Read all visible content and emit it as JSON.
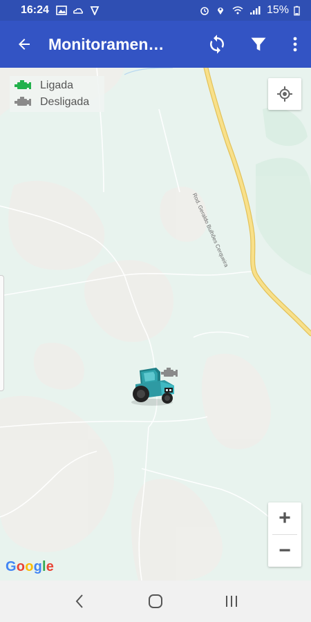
{
  "status_bar": {
    "time": "16:24",
    "battery": "15%",
    "icons": [
      "image-icon",
      "cloud-icon",
      "shield-icon",
      "alarm-icon",
      "location-icon",
      "wifi-icon",
      "signal-icon",
      "battery-icon"
    ]
  },
  "app_bar": {
    "title": "Monitoramen…",
    "back_icon": "arrow-left-icon",
    "refresh_icon": "sync-icon",
    "filter_icon": "filter-icon",
    "menu_icon": "more-vert-icon"
  },
  "legend": {
    "items": [
      {
        "label": "Ligada",
        "color": "#22b14c"
      },
      {
        "label": "Desligada",
        "color": "#8a8a8a"
      }
    ]
  },
  "map": {
    "road_label": "Rod. Geraldo Bulhões Cerqueira",
    "google_logo": "Google",
    "zoom_in": "+",
    "zoom_out": "−",
    "vehicle_status": "Desligada"
  },
  "nav_bar": {
    "back_icon": "nav-back-icon",
    "home_icon": "nav-home-icon",
    "recents_icon": "nav-recents-icon"
  },
  "colors": {
    "primary": "#3354c4",
    "status_bar": "#2f4fb3",
    "map_bg": "#e7f2ec",
    "road_yellow": "#f3d36b"
  }
}
